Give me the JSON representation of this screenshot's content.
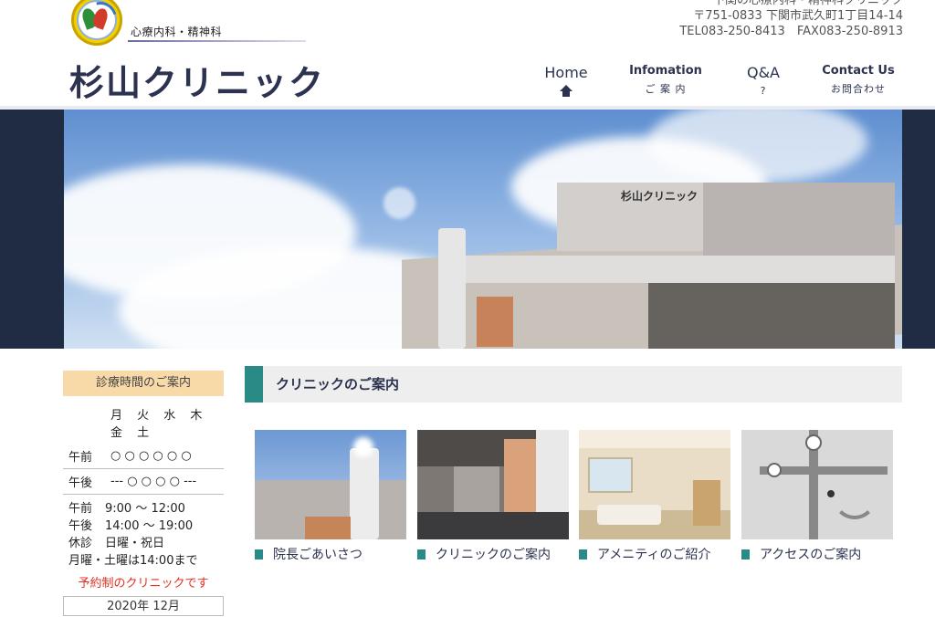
{
  "header": {
    "department": "心療内科・精神科",
    "clinic_name": "杉山クリニック",
    "address_line1": "下関の心療内科・精神科クリニック",
    "address_line2": "〒751-0833 下関市武久町1丁目14-14",
    "contact": "TEL083-250-8413　FAX083-250-8913"
  },
  "nav": [
    {
      "en": "Home",
      "jp": ""
    },
    {
      "en": "Infomation",
      "jp": "ご 案 内"
    },
    {
      "en": "Q&A",
      "jp": "?"
    },
    {
      "en": "Contact Us",
      "jp": "お問合わせ"
    }
  ],
  "sidebar": {
    "heading": "診療時間のご案内",
    "days_header": "月 火 水 木 金 土",
    "schedule": [
      {
        "label": "午前",
        "marks": "○ ○ ○ ○ ○ ○"
      },
      {
        "label": "午後",
        "marks": "--- ○ ○ ○ ○ ---"
      }
    ],
    "hours": [
      {
        "label": "午前",
        "value": "9:00 〜 12:00"
      },
      {
        "label": "午後",
        "value": "14:00 〜 19:00"
      },
      {
        "label": "休診",
        "value": "日曜・祝日"
      }
    ],
    "note": "月曜・土曜は14:00まで",
    "reserve": "予約制のクリニックです",
    "calendar_title": "2020年 12月"
  },
  "main": {
    "section_title": "クリニックのご案内",
    "cards": [
      {
        "caption": "院長ごあいさつ"
      },
      {
        "caption": "クリニックのご案内"
      },
      {
        "caption": "アメニティのご紹介"
      },
      {
        "caption": "アクセスのご案内"
      }
    ]
  },
  "hero": {
    "sign": "杉山クリニック"
  },
  "colors": {
    "accent": "#2a8a86",
    "navy": "#2c3350",
    "sidebar_head": "#f8d9a8",
    "reserve": "#e0301e"
  },
  "icons": [
    "clinic-emblem-icon",
    "home-icon"
  ]
}
